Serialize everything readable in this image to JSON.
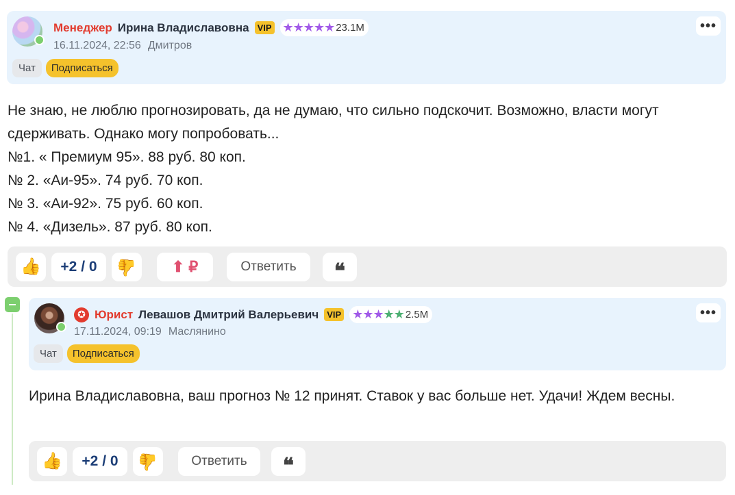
{
  "comments": [
    {
      "role": "Менеджер",
      "name": "Ирина Владиславовна",
      "vip": "VIP",
      "stars": "★★★★★",
      "rating": "23.1M",
      "date": "16.11.2024, 22:56",
      "city": "Дмитров",
      "chat_label": "Чат",
      "subscribe_label": "Подписаться",
      "text": [
        "Не знаю, не люблю прогнозировать, да не думаю, что сильно подскочит. Возможно, власти могут сдерживать. Однако могу попробовать...",
        "№1. « Премиум 95». 88 руб. 80 коп.",
        "№ 2. «Аи-95». 74 руб. 70 коп.",
        "№ 3. «Аи-92». 75 руб. 60 коп.",
        "№ 4. «Дизель». 87 руб. 80 коп."
      ],
      "score": "+2 / 0",
      "money_label": "⬆ ₽",
      "reply_label": "Ответить",
      "quote_icon": "❝"
    },
    {
      "role": "Юрист",
      "name": "Левашов Дмитрий Валерьевич",
      "vip": "VIP",
      "stars_purple": "★★★",
      "stars_green": "★★",
      "rating": "2.5M",
      "date": "17.11.2024, 09:19",
      "city": "Маслянино",
      "chat_label": "Чат",
      "subscribe_label": "Подписаться",
      "text": [
        "Ирина Владиславовна, ваш прогноз № 12 принят. Ставок у вас больше нет. Удачи! Ждем весны."
      ],
      "score": "+2 / 0",
      "reply_label": "Ответить",
      "quote_icon": "❝"
    }
  ],
  "icons": {
    "more": "•••",
    "thumb_up": "👍",
    "thumb_down": "👍",
    "lawyer": "✪"
  },
  "colors": {
    "header_bg": "#e8f3fd",
    "role_red": "#e23b2e",
    "vip_yellow": "#f5c22c",
    "star_purple": "#a15ae8",
    "star_green": "#4caf72",
    "online_green": "#7ccf6e",
    "score_blue": "#1c3e77",
    "action_bg": "#eeeeee"
  }
}
